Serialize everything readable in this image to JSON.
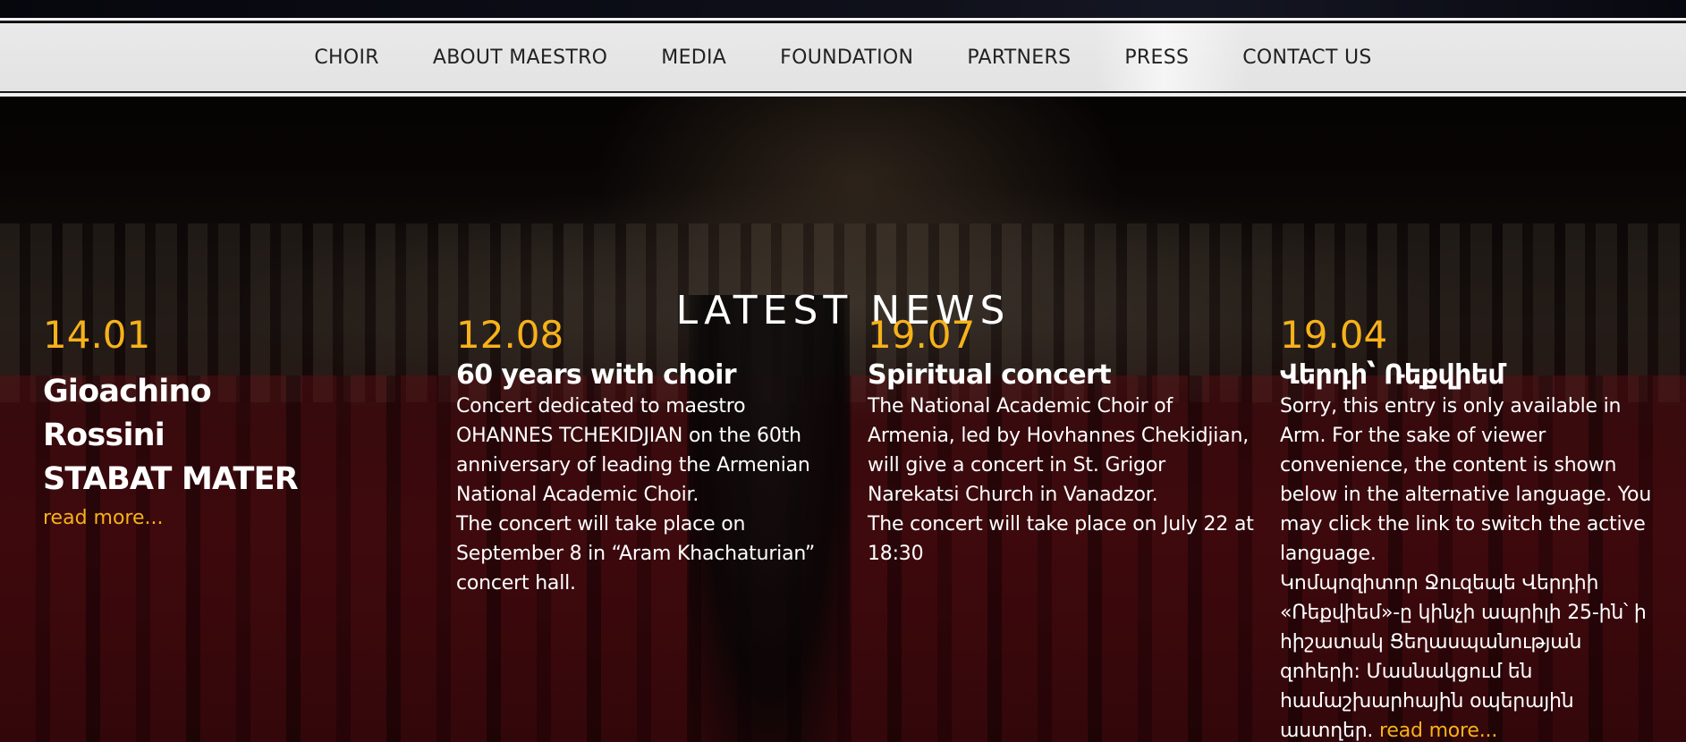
{
  "nav": {
    "items": [
      {
        "label": "CHOIR"
      },
      {
        "label": "ABOUT MAESTRO"
      },
      {
        "label": "MEDIA"
      },
      {
        "label": "FOUNDATION"
      },
      {
        "label": "PARTNERS"
      },
      {
        "label": "PRESS"
      },
      {
        "label": "CONTACT US"
      }
    ]
  },
  "news": {
    "title": "LATEST NEWS",
    "items": [
      {
        "date": "14.01",
        "title_line1": "Gioachino Rossini",
        "title_line2": "STABAT MATER",
        "read_more": "read more..."
      },
      {
        "date": "12.08",
        "title": "60 years with choir",
        "paragraphs": [
          "Concert dedicated to maestro OHANNES TCHEKIDJIAN on the 60th anniversary of leading the Armenian National Academic Choir.",
          "The concert will take place on September 8 in “Aram Khachaturian” concert hall."
        ]
      },
      {
        "date": "19.07",
        "title": "Spiritual concert",
        "paragraphs": [
          "The National Academic Choir of Armenia, led by Hovhannes Chekidjian, will give a concert in St. Grigor Narekatsi Church in Vanadzor.",
          "The concert will take place on July 22 at 18:30"
        ]
      },
      {
        "date": "19.04",
        "title": "Վերդի՝ Ռեքվիեմ",
        "paragraphs": [
          "Sorry, this entry is only available in Arm. For the sake of viewer convenience, the content is shown below in the alternative language. You may click the link to switch the active language."
        ],
        "arm_text": "Կոմպոզիտոր Ջուզեպե Վերդիի «Ռեքվիեմ»-ը կինչի ապրիլի 25-ին՝ ի հիշատակ Ցեղասպանության զոհերի: Մասնակցում են համաշխարհային օպերային աստղեր.",
        "read_more": "read more..."
      }
    ]
  },
  "colors": {
    "accent": "#f7b21a",
    "nav_bg": "#e6e6e7",
    "nav_text": "#222222",
    "text": "#ffffff"
  }
}
